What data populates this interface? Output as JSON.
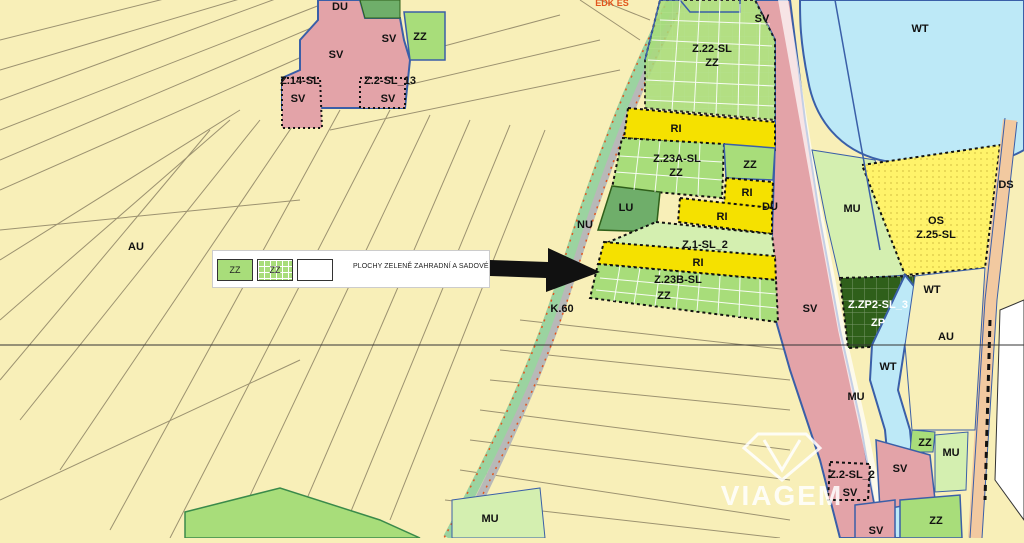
{
  "colors": {
    "agri": "#f8efb8",
    "residential": "#e3a3a8",
    "garden": "#a8dd7a",
    "garden_light": "#d4efb0",
    "individual_rec": "#f5e100",
    "recreation": "#fff36a",
    "water": "#bde9f7",
    "forest": "#6fae6a",
    "protection": "#2f5f1a",
    "boundary": "#3a5fa8"
  },
  "legend": {
    "swatch1_code": "ZZ",
    "swatch2_code": "ZZ",
    "text": "PLOCHY ZELENĚ ZAHRADNÍ A SADOVÉ"
  },
  "labels": {
    "du_top": "DU",
    "sv_a": "SV",
    "sv_b": "SV",
    "zz_a": "ZZ",
    "z14": "Z.14-SL",
    "sv_c": "SV",
    "z2_13": "Z.2-SL_13",
    "sv_d": "SV",
    "sv_top_right": "SV",
    "wt_top": "WT",
    "z22": "Z.22-SL",
    "zz_z22": "ZZ",
    "ri_1": "RI",
    "z23a": "Z.23A-SL",
    "zz_z23a": "ZZ",
    "zz_right": "ZZ",
    "ri_2": "RI",
    "lu": "LU",
    "ri_3": "RI",
    "du_mid": "DU",
    "nu": "NU",
    "z1_2": "Z.1-SL_2",
    "ri_4": "RI",
    "z23b": "Z.23B-SL",
    "zz_z23b": "ZZ",
    "k60": "K.60",
    "au_left": "AU",
    "mu_right": "MU",
    "os": "OS",
    "z25": "Z.25-SL",
    "ds": "DS",
    "sv_mid": "SV",
    "zzp2": "Z.ZP2-SL_3",
    "zp": "ZP",
    "wt_mid": "WT",
    "au_right": "AU",
    "wt_low": "WT",
    "mu_low": "MU",
    "zz_low1": "ZZ",
    "mu_low2": "MU",
    "z2_2": "Z.2-SL_2",
    "sv_low1": "SV",
    "sv_low2": "SV",
    "sv_bottom": "SV",
    "zz_bottom": "ZZ",
    "mu_bottom": "MU",
    "edge_top": "EDK ES"
  },
  "watermark": {
    "text": "VIAGEM"
  }
}
